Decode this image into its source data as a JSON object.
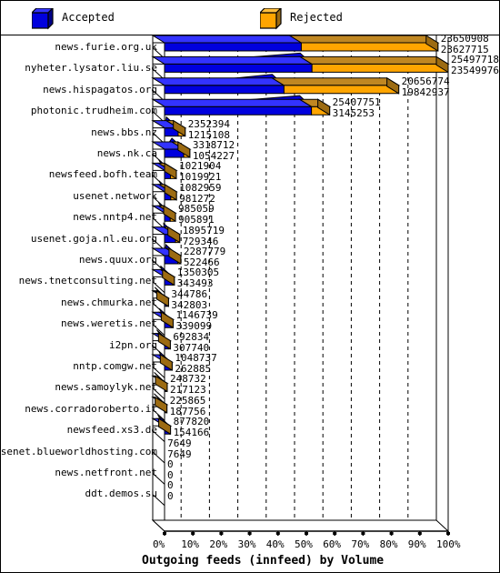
{
  "legend": {
    "items": [
      {
        "label": "Accepted",
        "color": "#0000dd"
      },
      {
        "label": "Rejected",
        "color": "#ffa500"
      }
    ]
  },
  "axis": {
    "x_title": "Outgoing feeds (innfeed) by Volume",
    "x_ticks": [
      "0%",
      "10%",
      "20%",
      "30%",
      "40%",
      "50%",
      "60%",
      "70%",
      "80%",
      "90%",
      "100%"
    ]
  },
  "colors": {
    "accepted": "#0000dd",
    "accepted_side": "#000088",
    "accepted_top": "#3333ff",
    "rejected": "#ffa500",
    "rejected_side": "#9c6b12",
    "rejected_top": "#c08722",
    "outline": "#000000",
    "background": "#ffffff"
  },
  "chart_data": {
    "type": "bar",
    "orientation": "horizontal",
    "stacked": true,
    "title": "Outgoing feeds (innfeed) by Volume",
    "xlabel": "Outgoing feeds (innfeed) by Volume",
    "ylabel": "",
    "xlim": [
      0,
      100
    ],
    "xunit": "percent",
    "grid": true,
    "legend_position": "top",
    "categories": [
      "news.furie.org.uk",
      "nyheter.lysator.liu.se",
      "news.hispagatos.org",
      "photonic.trudheim.com",
      "news.bbs.nz",
      "news.nk.ca",
      "newsfeed.bofh.team",
      "usenet.network",
      "news.nntp4.net",
      "usenet.goja.nl.eu.org",
      "news.quux.org",
      "news.tnetconsulting.net",
      "news.chmurka.net",
      "news.weretis.net",
      "i2pn.org",
      "nntp.comgw.net",
      "news.samoylyk.net",
      "news.corradoroberto.it",
      "newsfeed.xs3.de",
      "usenet.blueworldhosting.com",
      "news.netfront.net",
      "ddt.demos.su"
    ],
    "series": [
      {
        "name": "Accepted",
        "values": [
          23650908,
          25497718,
          20656774,
          25407751,
          2352394,
          3318712,
          1021904,
          1082959,
          985059,
          1895719,
          2287779,
          1350305,
          344786,
          1146739,
          692834,
          1048737,
          248732,
          225865,
          877820,
          7649,
          0,
          0
        ]
      },
      {
        "name": "Rejected",
        "values": [
          23627715,
          23549976,
          19842937,
          3145253,
          1215108,
          1054227,
          1019921,
          981272,
          905891,
          729346,
          522466,
          343493,
          342803,
          339099,
          307740,
          262885,
          217123,
          187756,
          154166,
          7649,
          0,
          0
        ]
      }
    ]
  }
}
